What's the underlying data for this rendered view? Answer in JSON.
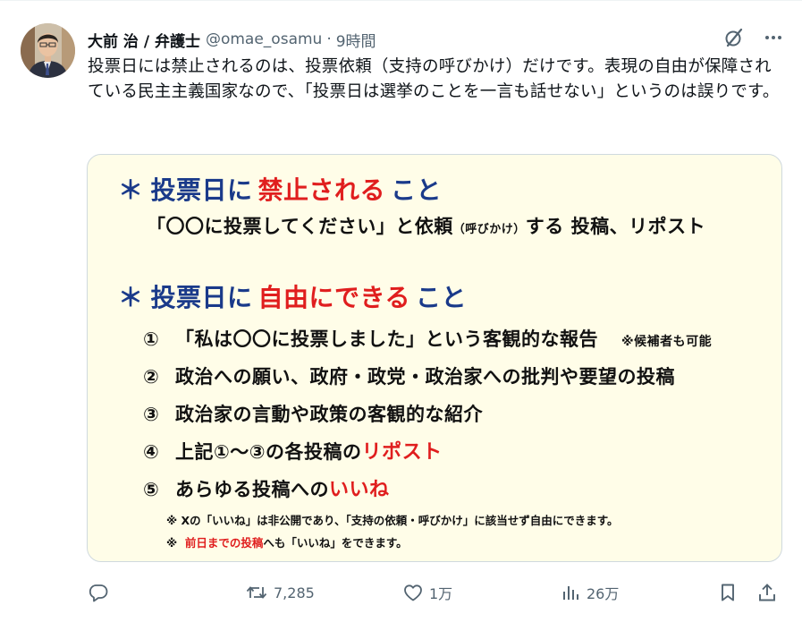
{
  "author": {
    "name": "大前 治 / 弁護士",
    "handle": "@omae_osamu",
    "separator": "·",
    "time": "9時間"
  },
  "tweet": {
    "text": "投票日には禁止されるのは、投票依頼（支持の呼びかけ）だけです。表現の自由が保障されている民主主義国家なので、「投票日は選挙のことを一言も話せない」というのは誤りです。"
  },
  "card": {
    "section1": {
      "star": "＊",
      "prefix": "投票日に",
      "highlight": "禁止される",
      "suffix": "こと"
    },
    "section1_body": {
      "main": "「〇〇に投票してください」と依頼",
      "paren": "（呼びかけ）",
      "rest": "する 投稿、リポスト"
    },
    "section2": {
      "star": "＊",
      "prefix": "投票日に",
      "highlight": "自由にできる",
      "suffix": "こと"
    },
    "items": [
      {
        "num": "①",
        "text": "「私は〇〇に投票しました」という客観的な報告",
        "note": "※候補者も可能"
      },
      {
        "num": "②",
        "text": "政治への願い、政府・政党・政治家への批判や要望の投稿"
      },
      {
        "num": "③",
        "text": "政治家の言動や政策の客観的な紹介"
      },
      {
        "num": "④",
        "text": "上記①～③の各投稿の",
        "red": "リポスト"
      },
      {
        "num": "⑤",
        "text": "あらゆる投稿への",
        "red": "いいね"
      }
    ],
    "footnote1": "※ Xの「いいね」は非公開であり、「支持の依頼・呼びかけ」に該当せず自由にできます。",
    "footnote2": {
      "mark": "※",
      "red": "前日までの投稿",
      "rest": "へも「いいね」をできます。"
    }
  },
  "actions": {
    "replies": "",
    "reposts": "7,285",
    "likes": "1万",
    "views": "26万"
  },
  "colors": {
    "title_blue": "#1a3a8a",
    "highlight_red": "#e01e1e",
    "card_bg": "#fffde8",
    "muted": "#536471"
  }
}
